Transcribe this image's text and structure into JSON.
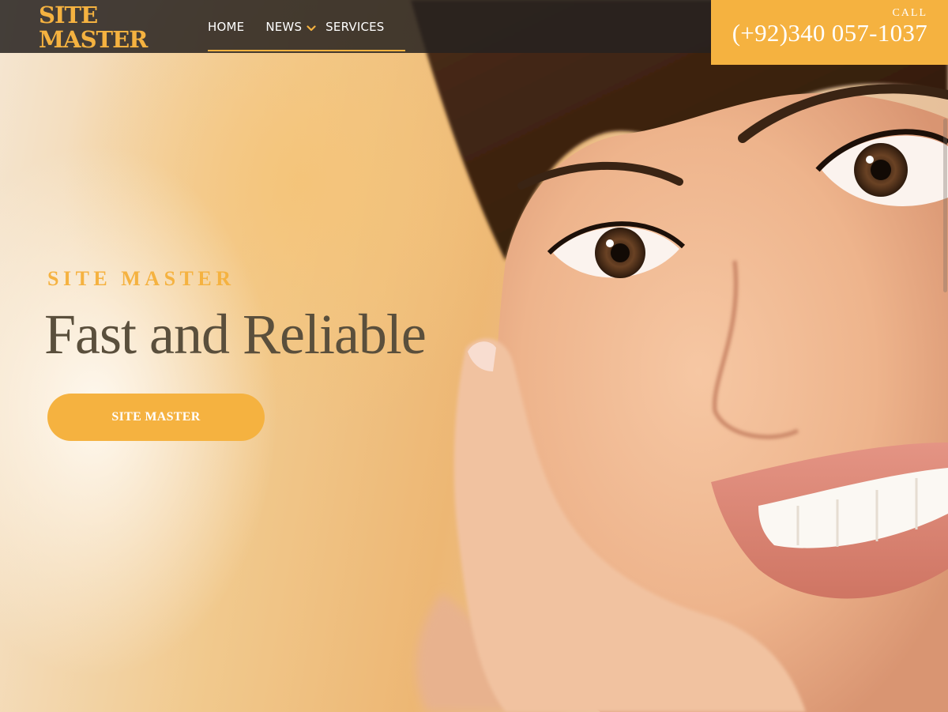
{
  "header": {
    "logo_line1": "SITE",
    "logo_line2": "MASTER",
    "nav": {
      "home": "HOME",
      "news": "NEWS",
      "services": "SERVICES"
    },
    "call": {
      "label": "CALL",
      "number": "(+92)340 057-1037"
    }
  },
  "hero": {
    "kicker": "SITE MASTER",
    "headline": "Fast and Reliable",
    "cta_label": "SITE MASTER",
    "image_subject": "smiling woman resting cheek on hand"
  },
  "colors": {
    "accent": "#f5b240",
    "header_bg": "#26221f",
    "headline": "#5a4f3c",
    "white": "#ffffff"
  },
  "icons": {
    "news_dropdown": "chevron-down-icon"
  }
}
